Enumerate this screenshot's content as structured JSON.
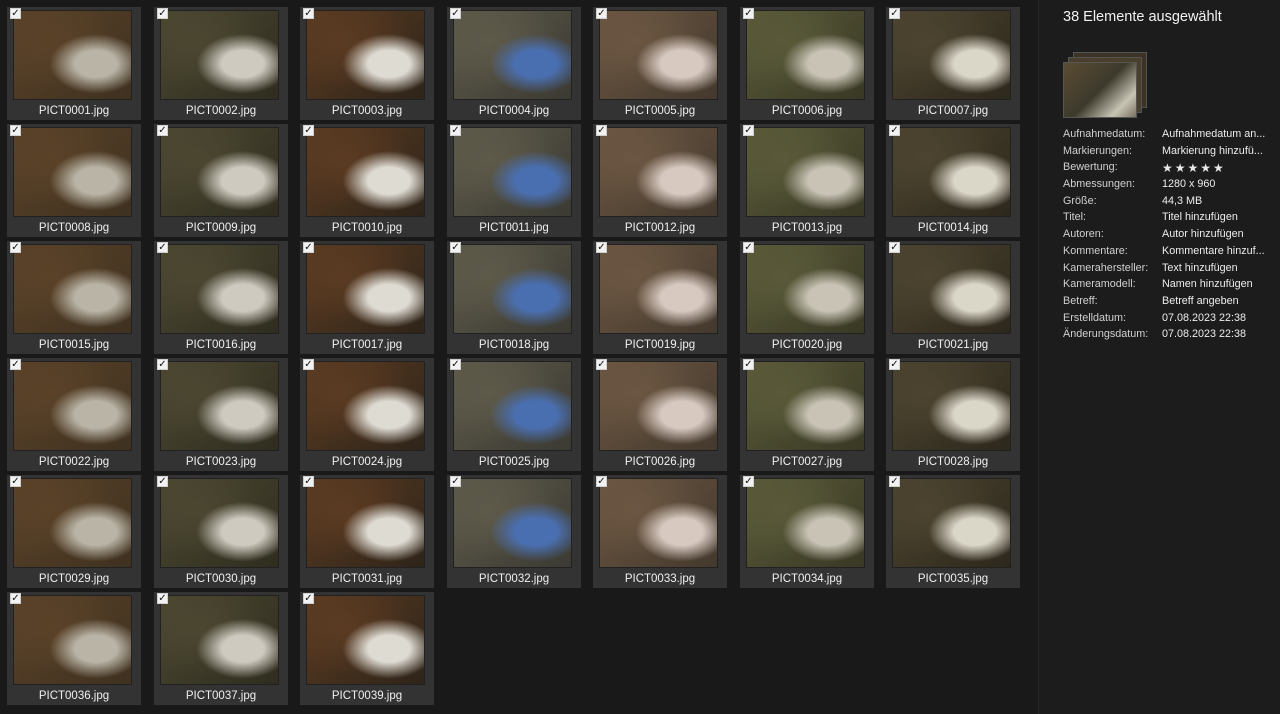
{
  "files": [
    {
      "name": "PICT0001.jpg",
      "checked": true
    },
    {
      "name": "PICT0002.jpg",
      "checked": true
    },
    {
      "name": "PICT0003.jpg",
      "checked": true
    },
    {
      "name": "PICT0004.jpg",
      "checked": true
    },
    {
      "name": "PICT0005.jpg",
      "checked": true
    },
    {
      "name": "PICT0006.jpg",
      "checked": true
    },
    {
      "name": "PICT0007.jpg",
      "checked": true
    },
    {
      "name": "PICT0008.jpg",
      "checked": true
    },
    {
      "name": "PICT0009.jpg",
      "checked": true
    },
    {
      "name": "PICT0010.jpg",
      "checked": true
    },
    {
      "name": "PICT0011.jpg",
      "checked": true
    },
    {
      "name": "PICT0012.jpg",
      "checked": true
    },
    {
      "name": "PICT0013.jpg",
      "checked": true
    },
    {
      "name": "PICT0014.jpg",
      "checked": true
    },
    {
      "name": "PICT0015.jpg",
      "checked": true
    },
    {
      "name": "PICT0016.jpg",
      "checked": true
    },
    {
      "name": "PICT0017.jpg",
      "checked": true
    },
    {
      "name": "PICT0018.jpg",
      "checked": true
    },
    {
      "name": "PICT0019.jpg",
      "checked": true
    },
    {
      "name": "PICT0020.jpg",
      "checked": true
    },
    {
      "name": "PICT0021.jpg",
      "checked": true
    },
    {
      "name": "PICT0022.jpg",
      "checked": true
    },
    {
      "name": "PICT0023.jpg",
      "checked": true
    },
    {
      "name": "PICT0024.jpg",
      "checked": true
    },
    {
      "name": "PICT0025.jpg",
      "checked": true
    },
    {
      "name": "PICT0026.jpg",
      "checked": true
    },
    {
      "name": "PICT0027.jpg",
      "checked": true
    },
    {
      "name": "PICT0028.jpg",
      "checked": true
    },
    {
      "name": "PICT0029.jpg",
      "checked": true
    },
    {
      "name": "PICT0030.jpg",
      "checked": true
    },
    {
      "name": "PICT0031.jpg",
      "checked": true
    },
    {
      "name": "PICT0032.jpg",
      "checked": true
    },
    {
      "name": "PICT0033.jpg",
      "checked": true
    },
    {
      "name": "PICT0034.jpg",
      "checked": true
    },
    {
      "name": "PICT0035.jpg",
      "checked": true
    },
    {
      "name": "PICT0036.jpg",
      "checked": true
    },
    {
      "name": "PICT0037.jpg",
      "checked": true
    },
    {
      "name": "PICT0039.jpg",
      "checked": true
    }
  ],
  "details": {
    "title": "38 Elemente ausgewählt",
    "properties": [
      {
        "label": "Aufnahmedatum:",
        "value": "Aufnahmedatum an..."
      },
      {
        "label": "Markierungen:",
        "value": "Markierung hinzufü..."
      },
      {
        "label": "Bewertung:",
        "value": "★★★★★",
        "kind": "stars"
      },
      {
        "label": "Abmessungen:",
        "value": "1280 x 960"
      },
      {
        "label": "Größe:",
        "value": "44,3 MB"
      },
      {
        "label": "Titel:",
        "value": "Titel hinzufügen"
      },
      {
        "label": "Autoren:",
        "value": "Autor hinzufügen"
      },
      {
        "label": "Kommentare:",
        "value": "Kommentare hinzuf..."
      },
      {
        "label": "Kamerahersteller:",
        "value": "Text hinzufügen"
      },
      {
        "label": "Kameramodell:",
        "value": "Namen hinzufügen"
      },
      {
        "label": "Betreff:",
        "value": "Betreff angeben"
      },
      {
        "label": "Erstelldatum:",
        "value": "07.08.2023 22:38"
      },
      {
        "label": "Änderungsdatum:",
        "value": "07.08.2023 22:38"
      }
    ]
  },
  "colors": {
    "background": "#191919",
    "tile": "#333333",
    "text": "#f0f0f0"
  },
  "icons": {
    "checkbox": "check-mark"
  }
}
